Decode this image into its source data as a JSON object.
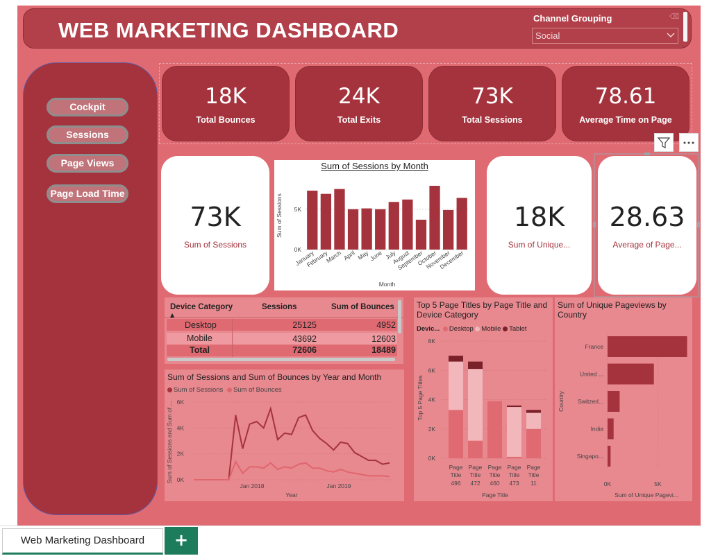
{
  "header": {
    "title": "WEB MARKETING DASHBOARD",
    "slicer_label": "Channel Grouping",
    "slicer_value": "Social"
  },
  "nav": {
    "buttons": [
      "Cockpit",
      "Sessions",
      "Page Views",
      "Page Load Time"
    ]
  },
  "kpis": [
    {
      "value": "18K",
      "label": "Total Bounces"
    },
    {
      "value": "24K",
      "label": "Total Exits"
    },
    {
      "value": "73K",
      "label": "Total Sessions"
    },
    {
      "value": "78.61",
      "label": "Average Time on Page"
    }
  ],
  "cards": [
    {
      "value": "73K",
      "label": "Sum of Sessions"
    },
    {
      "value": "18K",
      "label": "Sum of Unique..."
    },
    {
      "value": "28.63",
      "label": "Average of Page..."
    }
  ],
  "device_table": {
    "headers": [
      "Device Category",
      "Sessions",
      "Sum of Bounces"
    ],
    "rows": [
      {
        "category": "Desktop",
        "sessions": "25125",
        "bounces": "4952"
      },
      {
        "category": "Mobile",
        "sessions": "43692",
        "bounces": "12603"
      }
    ],
    "total": {
      "category": "Total",
      "sessions": "72606",
      "bounces": "18489"
    }
  },
  "chart_data": [
    {
      "type": "bar",
      "title": "Sum of Sessions by Month",
      "xlabel": "Month",
      "ylabel": "Sum of Sessions",
      "categories": [
        "January",
        "February",
        "March",
        "April",
        "May",
        "June",
        "July",
        "August",
        "September",
        "October",
        "November",
        "December"
      ],
      "values": [
        7300,
        6900,
        7500,
        5000,
        5100,
        5000,
        5900,
        6200,
        3700,
        7900,
        4900,
        6400
      ],
      "ylim": [
        0,
        8500
      ],
      "yticks": [
        "0K",
        "5K"
      ],
      "grid": true
    },
    {
      "type": "line",
      "title": "Sum of Sessions and Sum of Bounces by Year and Month",
      "xlabel": "Year",
      "ylabel": "Sum of Sessions and Sum of ...",
      "x_ticks": [
        "Jan 2018",
        "Jan 2019"
      ],
      "yticks": [
        "0K",
        "2K",
        "4K",
        "6K"
      ],
      "ylim": [
        0,
        6000
      ],
      "series": [
        {
          "name": "Sum of Sessions",
          "color": "#a4333d",
          "values": [
            0,
            0,
            0,
            0,
            0,
            0,
            5000,
            2400,
            4300,
            4500,
            4000,
            5500,
            3100,
            3600,
            3500,
            4800,
            5000,
            3800,
            3200,
            2800,
            2300,
            2900,
            2800,
            2100,
            1800,
            1500,
            1500,
            1200,
            1300
          ]
        },
        {
          "name": "Sum of Bounces",
          "color": "#e0666e",
          "values": [
            0,
            0,
            0,
            0,
            0,
            0,
            1400,
            500,
            1000,
            1000,
            900,
            1300,
            800,
            1000,
            900,
            1200,
            1300,
            900,
            900,
            700,
            600,
            800,
            600,
            500,
            400,
            300,
            300,
            300,
            250
          ]
        }
      ],
      "legend": "top-left",
      "grid": true
    },
    {
      "type": "bar",
      "stacked": true,
      "title": "Top 5 Page Titles by Page Title and Device Category",
      "xlabel": "Page Title",
      "ylabel": "Top 5 Page Titles",
      "legend_title": "Devic...",
      "legend": "top-left",
      "categories": [
        "Page Title 496",
        "Page Title 472",
        "Page Title 460",
        "Page Title 473",
        "Page Title 11"
      ],
      "yticks": [
        "0K",
        "2K",
        "4K",
        "6K",
        "8K"
      ],
      "ylim": [
        0,
        8000
      ],
      "series": [
        {
          "name": "Desktop",
          "color": "#e06a72",
          "values": [
            3300,
            1200,
            3900,
            100,
            2000
          ]
        },
        {
          "name": "Mobile",
          "color": "#f2b7bb",
          "values": [
            3300,
            4900,
            0,
            3400,
            1100
          ]
        },
        {
          "name": "Tablet",
          "color": "#7a2029",
          "values": [
            400,
            500,
            0,
            100,
            200
          ]
        }
      ],
      "grid": true
    },
    {
      "type": "bar",
      "orientation": "horizontal",
      "title": "Sum of Unique Pageviews by Country",
      "xlabel": "Sum of Unique Pagevi...",
      "ylabel": "Country",
      "categories": [
        "France",
        "United ...",
        "Switzerl...",
        "India",
        "Singapo..."
      ],
      "values": [
        7900,
        4600,
        1200,
        600,
        300
      ],
      "xticks": [
        "0K",
        "5K"
      ],
      "xlim": [
        0,
        8000
      ],
      "grid": true
    }
  ],
  "tabs": {
    "active_label": "Web Marketing Dashboard",
    "add_label": "+"
  },
  "colors": {
    "primary": "#a4333d",
    "background": "#e06a72",
    "accent": "#1c7c5c"
  }
}
